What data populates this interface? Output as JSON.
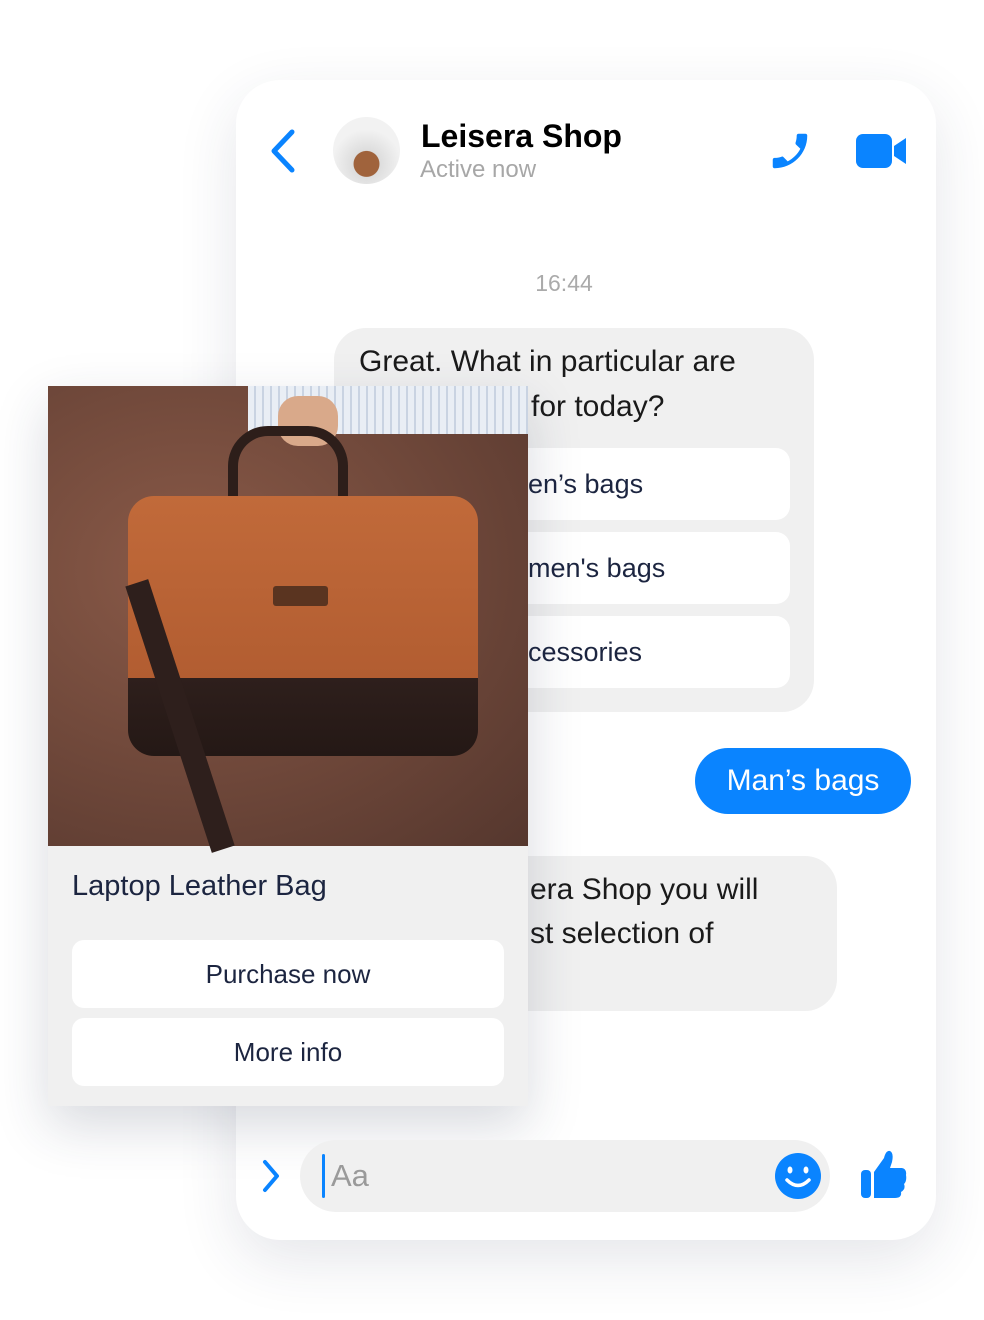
{
  "header": {
    "title": "Leisera Shop",
    "status": "Active now"
  },
  "chat": {
    "timestamp": "16:44",
    "bot_message_1": {
      "line1": "Great. What in particular are",
      "line2": "for today?"
    },
    "quick_replies": [
      "en’s bags",
      "men's bags",
      "cessories"
    ],
    "user_message": "Man’s bags",
    "bot_message_2": {
      "line1": "era Shop you will",
      "line2": "st selection of"
    }
  },
  "product_card": {
    "title": "Laptop Leather Bag",
    "buttons": [
      "Purchase now",
      "More info"
    ]
  },
  "composer": {
    "placeholder": "Aa"
  },
  "colors": {
    "accent": "#0a84ff",
    "bubble": "#f0f0f0",
    "text_dark": "#1c2540"
  }
}
